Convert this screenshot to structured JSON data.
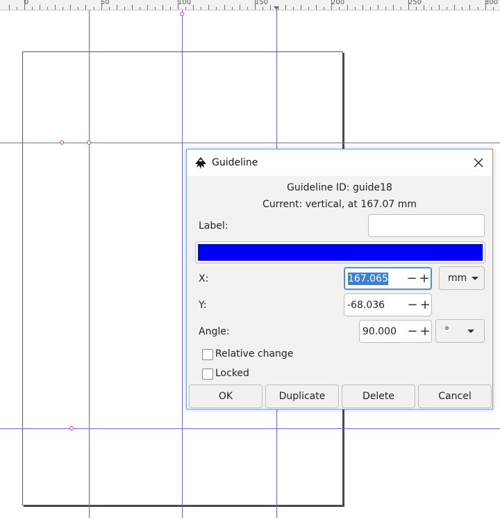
{
  "ruler": {
    "labels": [
      "0",
      "50",
      "100",
      "150",
      "200",
      "250",
      "300"
    ]
  },
  "dialog": {
    "title": "Guideline",
    "guideline_id": "Guideline ID: guide18",
    "current": "Current: vertical, at 167.07 mm",
    "label_caption": "Label:",
    "label_value": "",
    "color": "#0000ff",
    "x_caption": "X:",
    "x_value": "167.065",
    "unit": "mm",
    "y_caption": "Y:",
    "y_value": "-68.036",
    "angle_caption": "Angle:",
    "angle_value": "90.000",
    "angle_unit": "°",
    "relative_change": "Relative change",
    "locked": "Locked",
    "buttons": {
      "ok": "OK",
      "duplicate": "Duplicate",
      "delete": "Delete",
      "cancel": "Cancel"
    }
  },
  "guide_color": "#6a6ae6",
  "icons": [
    "inkscape-logo-icon",
    "close-icon",
    "minus-icon",
    "plus-icon",
    "dropdown-caret-icon"
  ]
}
